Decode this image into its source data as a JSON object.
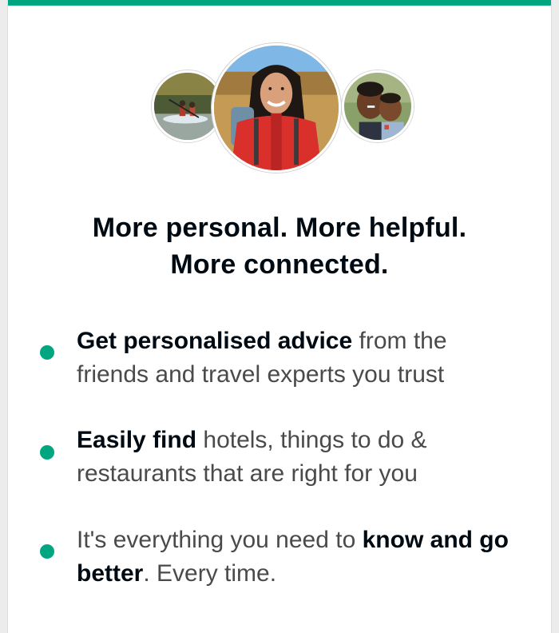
{
  "brand": {
    "accent": "#00a680",
    "text_dark": "#000a12",
    "text_body": "#4a4a4a"
  },
  "photos": [
    {
      "name": "kayaking-photo-icon"
    },
    {
      "name": "hiker-woman-photo-icon"
    },
    {
      "name": "father-child-photo-icon"
    }
  ],
  "headline": {
    "line1": "More personal. More helpful.",
    "line2": "More connected."
  },
  "features": [
    {
      "bold": "Get personalised advice",
      "rest": " from the friends and travel experts you trust"
    },
    {
      "bold": "Easily find",
      "rest": " hotels, things to do & restaurants that are right for you"
    },
    {
      "lead": "It's everything you need to ",
      "bold": "know and go better",
      "tail": ". Every time."
    }
  ]
}
